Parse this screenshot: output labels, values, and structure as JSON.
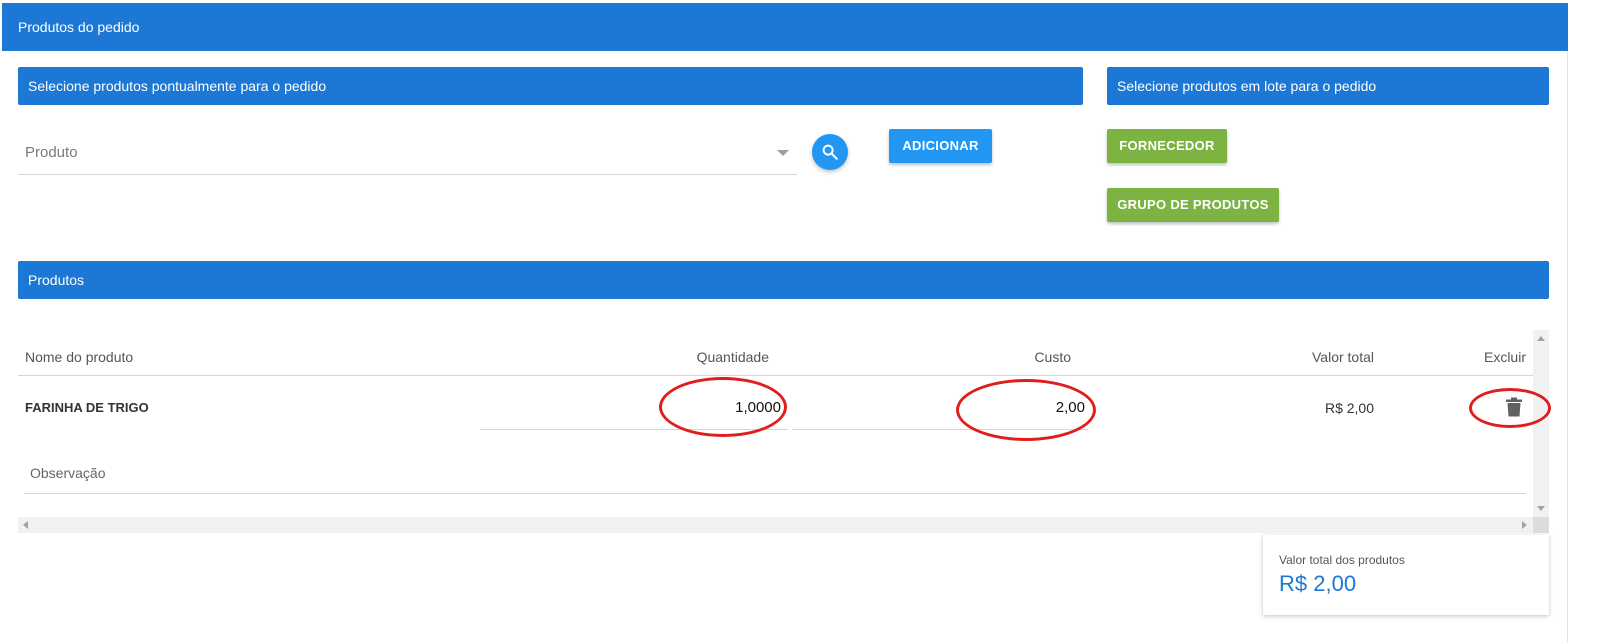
{
  "panel": {
    "title": "Produtos do pedido"
  },
  "single_select": {
    "header": "Selecione produtos pontualmente para o pedido",
    "product_placeholder": "Produto",
    "add_label": "ADICIONAR"
  },
  "batch_select": {
    "header": "Selecione produtos em lote para o pedido",
    "supplier_label": "FORNECEDOR",
    "group_label": "GRUPO DE PRODUTOS"
  },
  "products": {
    "header": "Produtos",
    "columns": {
      "name": "Nome do produto",
      "quantity": "Quantidade",
      "cost": "Custo",
      "total": "Valor total",
      "delete": "Excluir"
    },
    "rows": [
      {
        "name": "FARINHA DE TRIGO",
        "quantity": "1,0000",
        "cost": "2,00",
        "total": "R$ 2,00",
        "observation_label": "Observação"
      }
    ]
  },
  "summary": {
    "label": "Valor total dos produtos",
    "value": "R$ 2,00"
  },
  "icons": {
    "search": "search-icon",
    "delete": "trash-icon",
    "dropdown": "chevron-down-icon"
  },
  "colors": {
    "primary": "#1c78d4",
    "button_blue": "#2196f3",
    "button_green": "#7cb342",
    "annotation_red": "#e01e1e"
  }
}
